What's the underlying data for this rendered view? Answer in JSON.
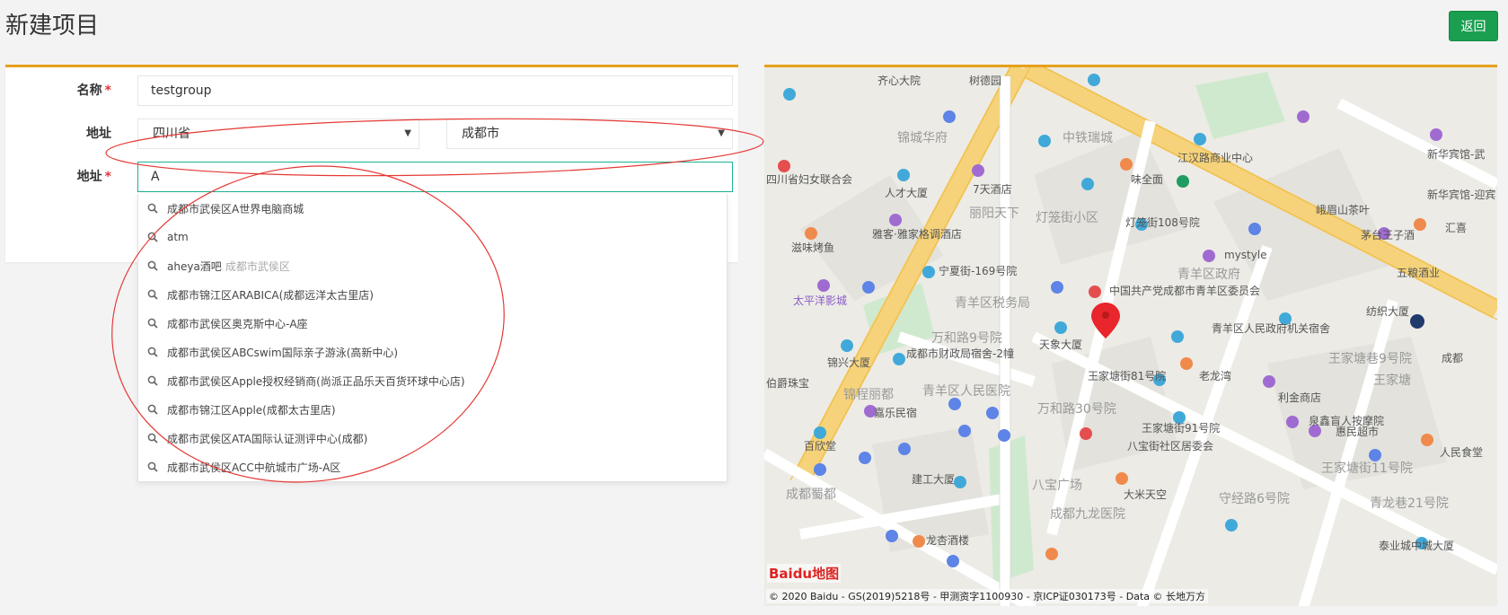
{
  "page": {
    "title": "新建项目",
    "back_label": "返回"
  },
  "form": {
    "name": {
      "label": "名称",
      "required": "*",
      "value": "testgroup"
    },
    "region": {
      "label": "地址",
      "province": "四川省",
      "city": "成都市"
    },
    "address": {
      "label": "地址",
      "required": "*",
      "value": "A"
    }
  },
  "suggestions": [
    {
      "main": "成都市武侯区A世界电脑商城",
      "sub": ""
    },
    {
      "main": "atm",
      "sub": ""
    },
    {
      "main": "aheya酒吧",
      "sub": "成都市武侯区"
    },
    {
      "main": "成都市锦江区ARABICA(成都远洋太古里店)",
      "sub": ""
    },
    {
      "main": "成都市武侯区奥克斯中心-A座",
      "sub": ""
    },
    {
      "main": "成都市武侯区ABCswim国际亲子游泳(高新中心)",
      "sub": ""
    },
    {
      "main": "成都市武侯区Apple授权经销商(尚派正品乐天百货环球中心店)",
      "sub": ""
    },
    {
      "main": "成都市锦江区Apple(成都太古里店)",
      "sub": ""
    },
    {
      "main": "成都市武侯区ATA国际认证测评中心(成都)",
      "sub": ""
    },
    {
      "main": "成都市武侯区ACC中航城市广场-A区",
      "sub": ""
    }
  ],
  "map": {
    "copyright": "© 2020 Baidu - GS(2019)5218号 - 甲测资字1100930 - 京ICP证030173号 - Data © 长地万方",
    "logo": "Baidu地图",
    "labels": [
      {
        "t": "齐心大院"
      },
      {
        "t": "树德园"
      },
      {
        "t": "锦城华府"
      },
      {
        "t": "中铁瑞城"
      },
      {
        "t": "江汉路商业中心"
      },
      {
        "t": "味全面"
      },
      {
        "t": "四川省妇女联合会"
      },
      {
        "t": "人才大厦"
      },
      {
        "t": "7天酒店"
      },
      {
        "t": "丽阳天下"
      },
      {
        "t": "灯笼街小区"
      },
      {
        "t": "灯笼街108号院"
      },
      {
        "t": "峨眉山茶叶"
      },
      {
        "t": "新华宾馆-武"
      },
      {
        "t": "新华宾馆-迎宾"
      },
      {
        "t": "滋味烤鱼"
      },
      {
        "t": "雅客·雅家格调酒店"
      },
      {
        "t": "茅台王子酒"
      },
      {
        "t": "汇喜"
      },
      {
        "t": "mystyle"
      },
      {
        "t": "五粮酒业"
      },
      {
        "t": "宁夏街-169号院"
      },
      {
        "t": "青羊区政府"
      },
      {
        "t": "太平洋影城"
      },
      {
        "t": "中国共产党成都市青羊区委员会"
      },
      {
        "t": "青羊区税务局"
      },
      {
        "t": "纺织大厦"
      },
      {
        "t": "万和路9号院"
      },
      {
        "t": "天象大厦"
      },
      {
        "t": "青羊区人民政府机关宿舍"
      },
      {
        "t": "锦兴大厦"
      },
      {
        "t": "成都市财政局宿舍-2幢"
      },
      {
        "t": "王家塘巷9号院"
      },
      {
        "t": "成都"
      },
      {
        "t": "王家塘街81号院"
      },
      {
        "t": "老龙湾"
      },
      {
        "t": "王家塘"
      },
      {
        "t": "伯爵珠宝"
      },
      {
        "t": "锦程丽都"
      },
      {
        "t": "青羊区人民医院"
      },
      {
        "t": "利金商店"
      },
      {
        "t": "万和路30号院"
      },
      {
        "t": "嘉乐民宿"
      },
      {
        "t": "泉鑫盲人按摩院"
      },
      {
        "t": "惠民超市"
      },
      {
        "t": "王家塘街91号院"
      },
      {
        "t": "人民食堂"
      },
      {
        "t": "百欣堂"
      },
      {
        "t": "八宝街社区居委会"
      },
      {
        "t": "王家塘街11号院"
      },
      {
        "t": "建工大厦"
      },
      {
        "t": "八宝广场"
      },
      {
        "t": "成都蜀都"
      },
      {
        "t": "大米天空"
      },
      {
        "t": "守经路6号院"
      },
      {
        "t": "青龙巷21号院"
      },
      {
        "t": "成都九龙医院"
      },
      {
        "t": "龙杏酒楼"
      },
      {
        "t": "泰业城中城大厦"
      }
    ]
  }
}
